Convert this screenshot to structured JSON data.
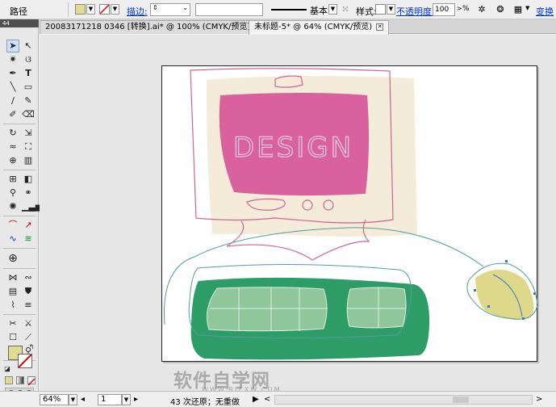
{
  "control_bar": {
    "selection_label": "路径",
    "stroke_link": "描边:",
    "brush_label": "基本",
    "style_label": "样式:",
    "opacity_link": "不透明度:",
    "opacity_value": "100",
    "opacity_unit": "%",
    "transform_link": "变换",
    "fill_color": "#dfdc92"
  },
  "toolbox": {
    "header": "44"
  },
  "tabs": [
    {
      "label": "20083171218 0346 [转换].ai* @ 100% (CMYK/预览)"
    },
    {
      "label": "未标题-5* @ 64% (CMYK/预览)"
    }
  ],
  "artwork": {
    "screen_text": "DESIGN",
    "colors": {
      "screen_pink": "#d9619d",
      "cream": "#f5ebd9",
      "keyboard_green": "#2e9c67",
      "key_green": "#8fc79b",
      "mouse_yellow": "#ddd88a"
    }
  },
  "status_bar": {
    "zoom": "64%",
    "artboard_num": "1",
    "status_text": "43 次还原；无重做"
  },
  "watermark": {
    "main": "软件自学网",
    "sub": "WWW.RJZXW.COM"
  }
}
